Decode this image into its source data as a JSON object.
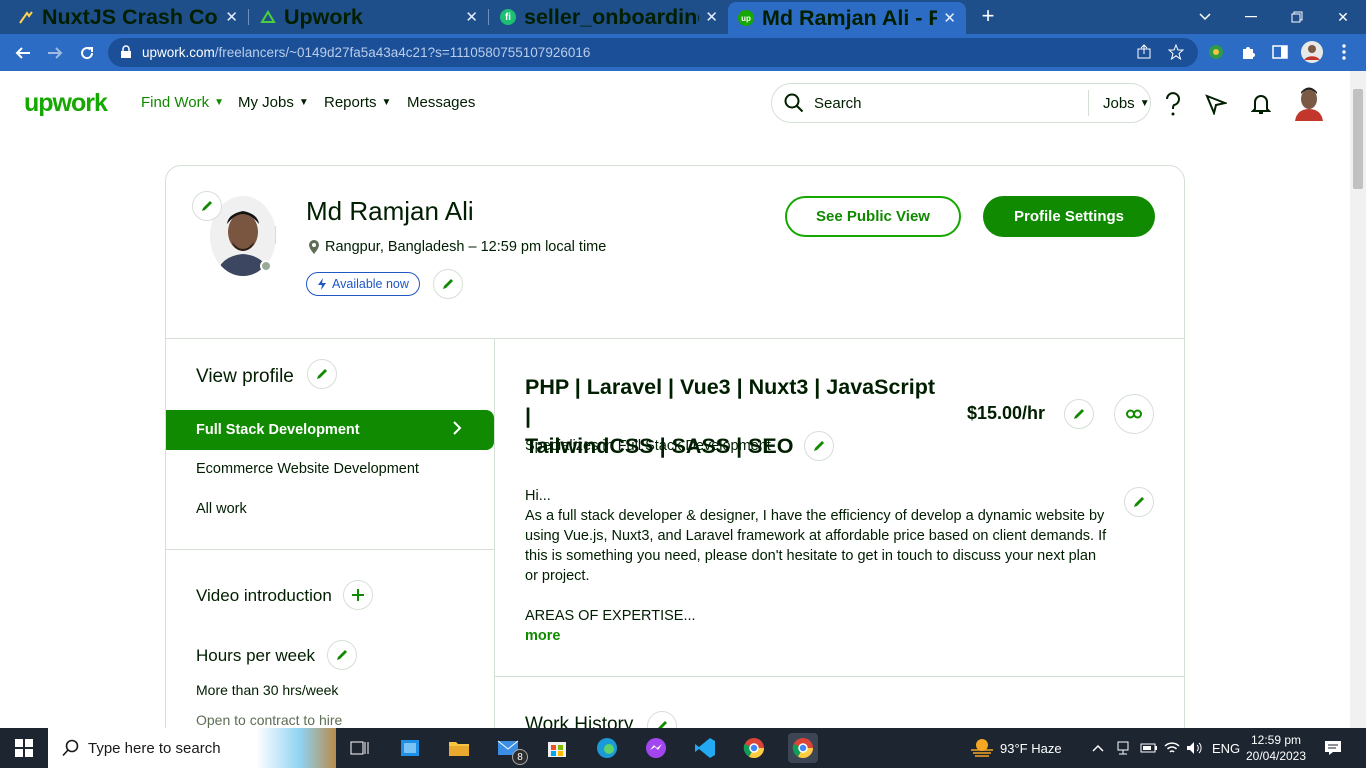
{
  "browser": {
    "tabs": [
      {
        "title": "NuxtJS Crash Course: Setting up"
      },
      {
        "title": "Upwork"
      },
      {
        "title": "seller_onboarding overview - five"
      },
      {
        "title": "Md Ramjan Ali - Frontend | Vue.js"
      }
    ],
    "new_tab": "+",
    "url_domain": "upwork.com",
    "url_path": "/freelancers/~0149d27fa5a43a4c21?s=1110580755107926016"
  },
  "header": {
    "logo": "upwork",
    "nav": [
      "Find Work",
      "My Jobs",
      "Reports",
      "Messages"
    ],
    "search_placeholder": "Search",
    "search_scope": "Jobs"
  },
  "profile": {
    "name": "Md Ramjan Ali",
    "location": "Rangpur, Bangladesh – 12:59 pm local time",
    "availability": "Available now",
    "see_public_view": "See Public View",
    "profile_settings": "Profile Settings"
  },
  "sidebar": {
    "view_profile": "View profile",
    "items": [
      "Full Stack Development",
      "Ecommerce Website Development",
      "All work"
    ],
    "video_intro": "Video introduction",
    "hours_title": "Hours per week",
    "hours_value": "More than 30 hrs/week",
    "contract": "Open to contract to hire"
  },
  "main": {
    "title_line1": "PHP | Laravel | Vue3 | Nuxt3 | JavaScript |",
    "title_line2": "TailwindCSS | SASS | SEO",
    "rate": "$15.00/hr",
    "specializes_prefix": "Specializes in",
    "specializes_value": "Full Stack Development",
    "bio_hi": "Hi...",
    "bio_body": "As a full stack developer & designer, I have the efficiency of develop a dynamic website by using Vue.js, Nuxt3, and Laravel framework at affordable price based on client demands. If this is something you need, please don't hesitate to get in touch to discuss your next plan or project.",
    "bio_expertise": "AREAS OF EXPERTISE...",
    "more": "more",
    "work_history": "Work History"
  },
  "taskbar": {
    "search_placeholder": "Type here to search",
    "mail_badge": "8",
    "weather": "93°F  Haze",
    "lang": "ENG",
    "time": "12:59 pm",
    "date": "20/04/2023"
  },
  "colors": {
    "brand": "#14a800",
    "brand_dark": "#108a00",
    "link_blue": "#1f57c3",
    "chrome_tab": "#1f4f8a",
    "chrome_toolbar": "#2c6cc4"
  }
}
